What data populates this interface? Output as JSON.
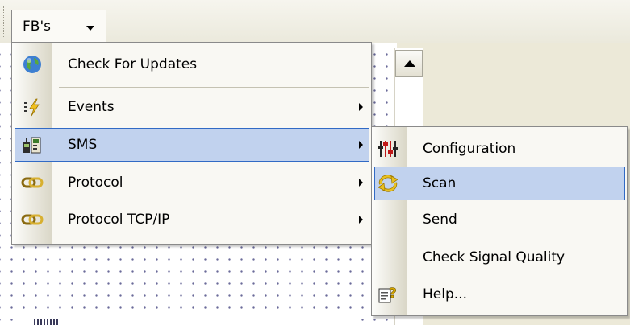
{
  "menubar": {
    "menu_title": "FB's"
  },
  "main_menu": {
    "items": [
      {
        "label": "Check For Updates",
        "icon": "globe-icon",
        "has_submenu": false
      },
      {
        "label": "Events",
        "icon": "lightning-events-icon",
        "has_submenu": true
      },
      {
        "label": "SMS",
        "icon": "sms-device-icon",
        "has_submenu": true,
        "highlighted": true
      },
      {
        "label": "Protocol",
        "icon": "chain-link-icon",
        "has_submenu": true
      },
      {
        "label": "Protocol TCP/IP",
        "icon": "chain-link-icon",
        "has_submenu": true
      }
    ]
  },
  "sms_submenu": {
    "items": [
      {
        "label": "Configuration",
        "icon": "config-sliders-icon"
      },
      {
        "label": "Scan",
        "icon": "refresh-scan-icon",
        "highlighted": true
      },
      {
        "label": "Send",
        "icon": ""
      },
      {
        "label": "Check Signal Quality",
        "icon": ""
      },
      {
        "label": "Help...",
        "icon": "help-icon"
      }
    ]
  },
  "colors": {
    "highlight_fill": "#c1d2ee",
    "highlight_border": "#316ac5",
    "menu_background": "#f9f8f3"
  }
}
